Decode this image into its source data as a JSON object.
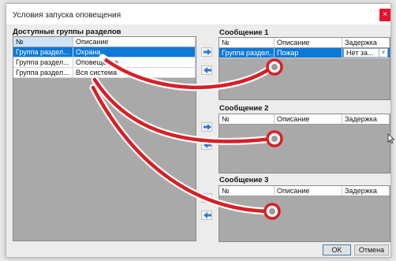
{
  "window": {
    "title": "Условия запуска оповещения",
    "close_glyph": "×"
  },
  "left_panel": {
    "title": "Доступные группы разделов",
    "columns": [
      "№",
      "Описание"
    ],
    "rows": [
      {
        "num": "Группа раздел...",
        "desc": "Охрана",
        "selected": true
      },
      {
        "num": "Группа раздел...",
        "desc": "Оповещение",
        "selected": false
      },
      {
        "num": "Группа раздел...",
        "desc": "Вся система",
        "selected": false
      }
    ]
  },
  "messages": [
    {
      "title": "Сообщение 1",
      "columns": [
        "№",
        "Описание",
        "Задержка"
      ],
      "rows": [
        {
          "num": "Группа раздел...",
          "desc": "Пожар",
          "delay": "Нет за..."
        }
      ]
    },
    {
      "title": "Сообщение 2",
      "columns": [
        "№",
        "Описание",
        "Задержка"
      ],
      "rows": []
    },
    {
      "title": "Сообщение 3",
      "columns": [
        "№",
        "Описание",
        "Задержка"
      ],
      "rows": []
    }
  ],
  "buttons": {
    "ok": "OK",
    "cancel": "Отмена"
  },
  "icons": {
    "add": "arrow-right-icon",
    "remove": "arrow-left-icon",
    "dropdown": "chevron-down-icon"
  },
  "colors": {
    "accent": "#0d79d9",
    "annotation": "#d81f26",
    "close": "#e8112d"
  }
}
